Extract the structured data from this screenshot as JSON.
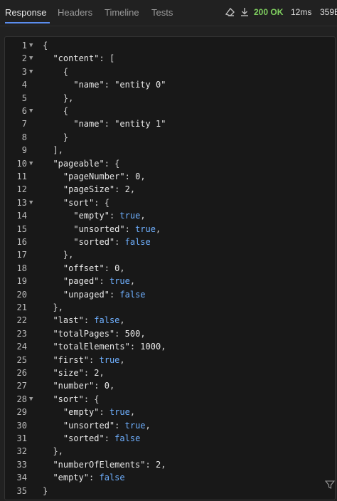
{
  "tabs": [
    {
      "label": "Response",
      "active": true
    },
    {
      "label": "Headers",
      "active": false
    },
    {
      "label": "Timeline",
      "active": false
    },
    {
      "label": "Tests",
      "active": false
    }
  ],
  "status": {
    "code_text": "200 OK",
    "time": "12ms",
    "size": "359B",
    "code_color": "#7fcf5f"
  },
  "icons": [
    "clear-icon",
    "download-icon",
    "filter-icon"
  ],
  "editor": {
    "lines": [
      {
        "n": "1",
        "fold": true,
        "code": "{"
      },
      {
        "n": "2",
        "fold": true,
        "code": "  \"content\": ["
      },
      {
        "n": "3",
        "fold": true,
        "code": "    {"
      },
      {
        "n": "4",
        "fold": false,
        "code": "      \"name\": \"entity 0\""
      },
      {
        "n": "5",
        "fold": false,
        "code": "    },"
      },
      {
        "n": "6",
        "fold": true,
        "code": "    {"
      },
      {
        "n": "7",
        "fold": false,
        "code": "      \"name\": \"entity 1\""
      },
      {
        "n": "8",
        "fold": false,
        "code": "    }"
      },
      {
        "n": "9",
        "fold": false,
        "code": "  ],"
      },
      {
        "n": "10",
        "fold": true,
        "code": "  \"pageable\": {"
      },
      {
        "n": "11",
        "fold": false,
        "code": "    \"pageNumber\": 0,"
      },
      {
        "n": "12",
        "fold": false,
        "code": "    \"pageSize\": 2,"
      },
      {
        "n": "13",
        "fold": true,
        "code": "    \"sort\": {"
      },
      {
        "n": "14",
        "fold": false,
        "code": "      \"empty\": true,"
      },
      {
        "n": "15",
        "fold": false,
        "code": "      \"unsorted\": true,"
      },
      {
        "n": "16",
        "fold": false,
        "code": "      \"sorted\": false"
      },
      {
        "n": "17",
        "fold": false,
        "code": "    },"
      },
      {
        "n": "18",
        "fold": false,
        "code": "    \"offset\": 0,"
      },
      {
        "n": "19",
        "fold": false,
        "code": "    \"paged\": true,"
      },
      {
        "n": "20",
        "fold": false,
        "code": "    \"unpaged\": false"
      },
      {
        "n": "21",
        "fold": false,
        "code": "  },"
      },
      {
        "n": "22",
        "fold": false,
        "code": "  \"last\": false,"
      },
      {
        "n": "23",
        "fold": false,
        "code": "  \"totalPages\": 500,"
      },
      {
        "n": "24",
        "fold": false,
        "code": "  \"totalElements\": 1000,"
      },
      {
        "n": "25",
        "fold": false,
        "code": "  \"first\": true,"
      },
      {
        "n": "26",
        "fold": false,
        "code": "  \"size\": 2,"
      },
      {
        "n": "27",
        "fold": false,
        "code": "  \"number\": 0,"
      },
      {
        "n": "28",
        "fold": true,
        "code": "  \"sort\": {"
      },
      {
        "n": "29",
        "fold": false,
        "code": "    \"empty\": true,"
      },
      {
        "n": "30",
        "fold": false,
        "code": "    \"unsorted\": true,"
      },
      {
        "n": "31",
        "fold": false,
        "code": "    \"sorted\": false"
      },
      {
        "n": "32",
        "fold": false,
        "code": "  },"
      },
      {
        "n": "33",
        "fold": false,
        "code": "  \"numberOfElements\": 2,"
      },
      {
        "n": "34",
        "fold": false,
        "code": "  \"empty\": false"
      },
      {
        "n": "35",
        "fold": false,
        "code": "}"
      }
    ]
  }
}
